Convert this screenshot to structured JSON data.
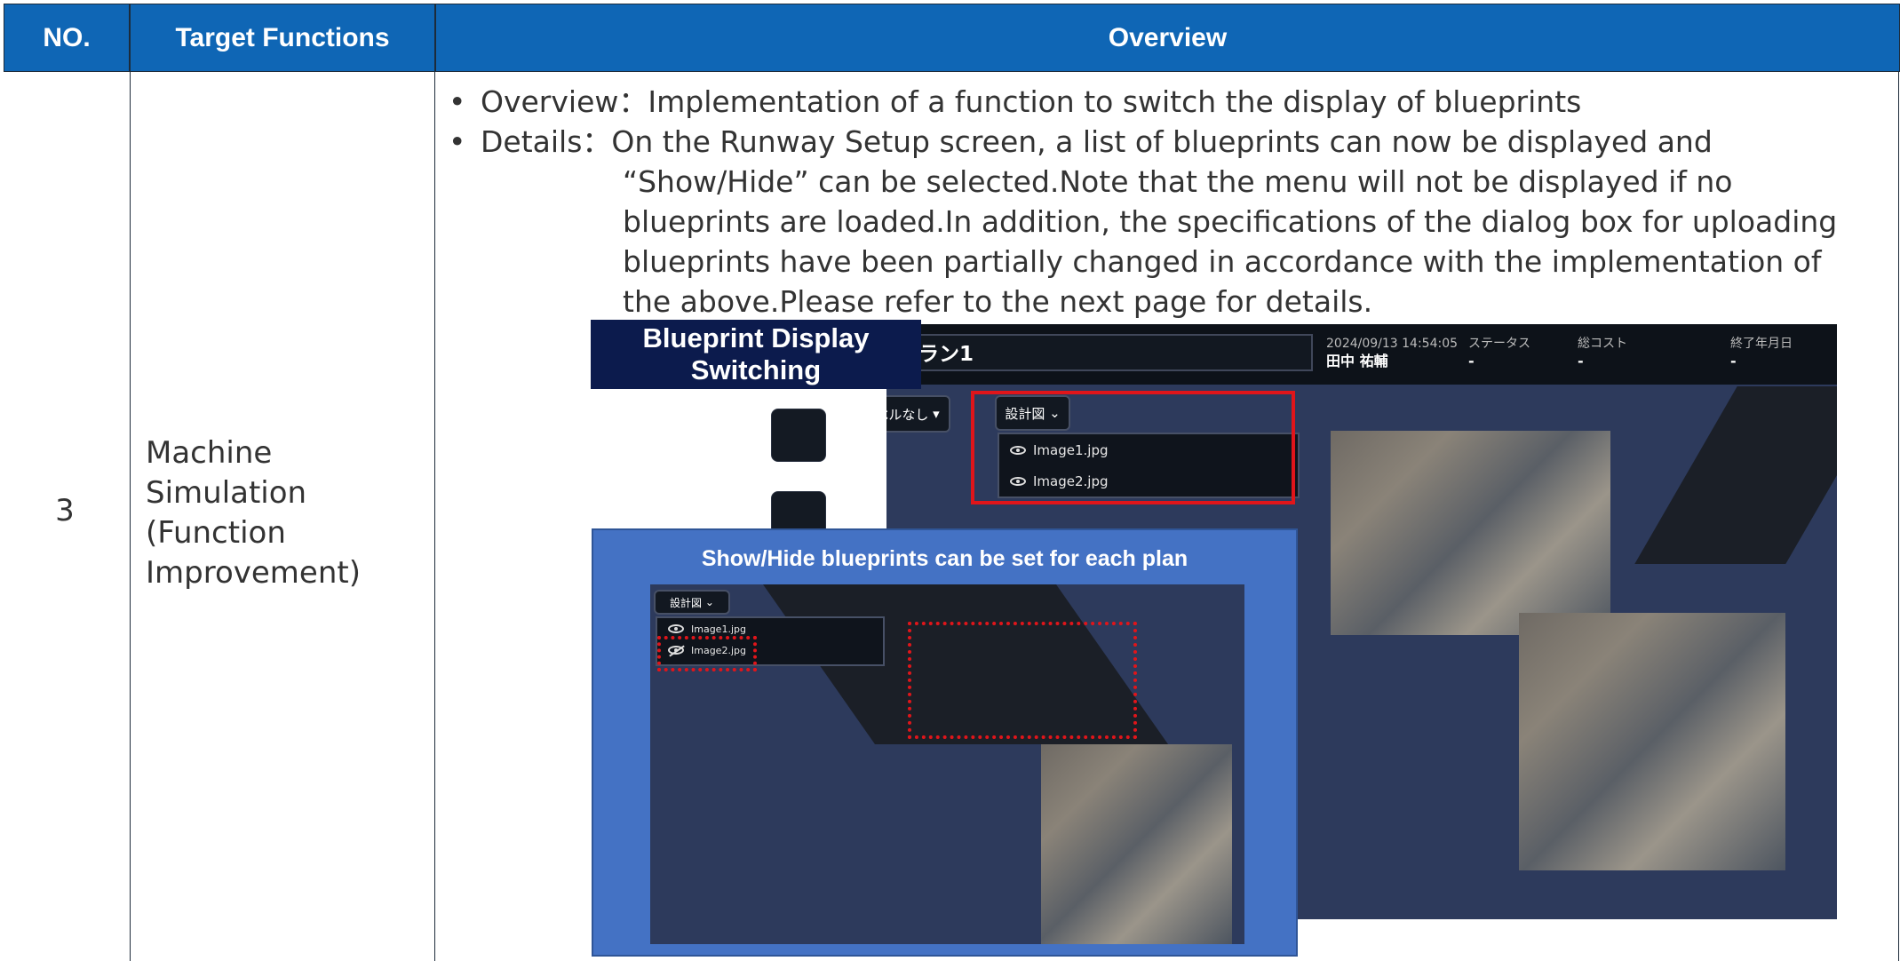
{
  "table": {
    "headers": {
      "no": "NO.",
      "functions": "Target Functions",
      "overview": "Overview"
    },
    "row": {
      "no": "3",
      "function_lines": [
        "Machine",
        "Simulation",
        "(Function",
        "Improvement)"
      ],
      "overview_label": "Overview：",
      "overview_text": "Implementation of a function to switch the display of blueprints",
      "details_label": "Details：",
      "details_lines": [
        "On the Runway Setup screen, a list of blueprints can now be displayed and",
        "“Show/Hide” can be selected.Note that the menu will not be displayed if no",
        "blueprints are loaded.In addition, the specifications of the dialog box for uploading",
        "blueprints have been partially changed in accordance with the implementation of",
        "the above.Please refer to the next page for details."
      ]
    }
  },
  "screenshot": {
    "plan_name": "ラン1",
    "datetime": "2024/09/13 14:54:05",
    "user": "田中 祐輔",
    "status_label": "ステータス",
    "status_value": "-",
    "cost_label": "総コスト",
    "cost_value": "-",
    "end_label": "終了年月日",
    "end_value": "-",
    "label_select": "ラベルなし",
    "blueprint_button": "設計図",
    "blueprint_items": [
      "Image1.jpg",
      "Image2.jpg"
    ]
  },
  "annotations": {
    "title_label": "Blueprint Display Switching",
    "callout_title": "Show/Hide blueprints can be set for each plan",
    "inner_button": "設計図",
    "inner_items": [
      "Image1.jpg",
      "Image2.jpg"
    ]
  },
  "colors": {
    "header_blue": "#0f66b5",
    "callout_blue": "#4472c4",
    "highlight_red": "#e0151a",
    "navy": "#0c1b4d"
  }
}
